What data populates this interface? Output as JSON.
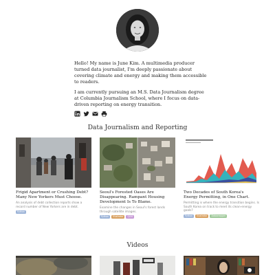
{
  "bio": {
    "paragraph1": "Hello! My name is June Kim. A multimedia producer turned data journalist, I'm deeply passionate about covering climate and energy and making them accessible to readers.",
    "paragraph2": "I am currently pursuing an M.S. Data Journalism degree at Columbia Journalism School, where I focus on data-driven reporting on energy transition."
  },
  "socials": [
    {
      "icon": "linkedin-icon"
    },
    {
      "icon": "twitter-icon"
    },
    {
      "icon": "email-icon"
    },
    {
      "icon": "print-icon"
    }
  ],
  "section_titles": {
    "data_journalism": "Data Journalism and Reporting",
    "videos": "Videos"
  },
  "articles": [
    {
      "title": "Frigid Apartment or Crushing Debt? Many New Yorkers Must Choose.",
      "description": "An analysis of debt collection reports show a record number of New Yorkers are in debt.",
      "tags": [
        {
          "label": "Python",
          "color": "#9db4d8"
        }
      ]
    },
    {
      "title": "Seoul's Forested Oases Are Disappearing. Rampant Housing Development Is To Blame.",
      "description": "Examine the changes in Seoul's forest lands through satellite images.",
      "tags": [
        {
          "label": "Python",
          "color": "#9db4d8"
        },
        {
          "label": "Illustrator",
          "color": "#d8a060"
        },
        {
          "label": "QGIS",
          "color": "#c79ad6"
        }
      ]
    },
    {
      "title": "Two Decades of South Korea's Energy Permitting, in One Chart.",
      "description": "Permitting is where the energy transition begins. Is South Korea on track to meet its clean-energy goals?",
      "tags": [
        {
          "label": "Python",
          "color": "#9db4d8"
        },
        {
          "label": "Illustrator",
          "color": "#d8a060"
        },
        {
          "label": "Datawrapper",
          "color": "#9fc99a"
        }
      ]
    }
  ],
  "videos": [
    {
      "name": "video-1"
    },
    {
      "name": "video-2"
    },
    {
      "name": "video-3"
    }
  ]
}
